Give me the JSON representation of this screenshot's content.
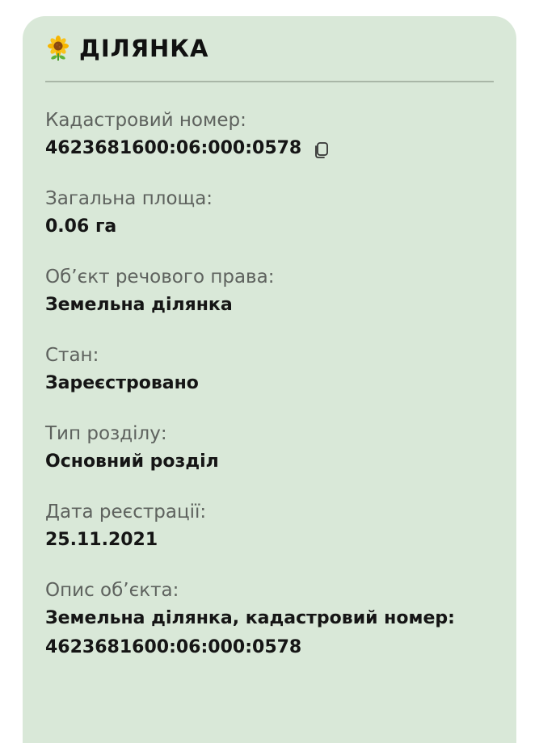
{
  "section": {
    "title": "ДІЛЯНКА",
    "icon": "sunflower-icon"
  },
  "fields": [
    {
      "label": "Кадастровий номер:",
      "value": "4623681600:06:000:0578",
      "copy_icon": "copy-icon"
    },
    {
      "label": "Загальна площа:",
      "value": "0.06 га"
    },
    {
      "label": "Об’єкт речового права:",
      "value": "Земельна ділянка"
    },
    {
      "label": "Стан:",
      "value": "Зареєстровано"
    },
    {
      "label": "Тип розділу:",
      "value": "Основний розділ"
    },
    {
      "label": "Дата реєстрації:",
      "value": "25.11.2021"
    },
    {
      "label": "Опис об’єкта:",
      "value": "Земельна ділянка, кадастровий номер: 4623681600:06:000:0578"
    }
  ],
  "colors": {
    "card_bg": "#d9e8d8",
    "label": "#5e625e",
    "value": "#151515",
    "divider": "#a9b6a7"
  }
}
